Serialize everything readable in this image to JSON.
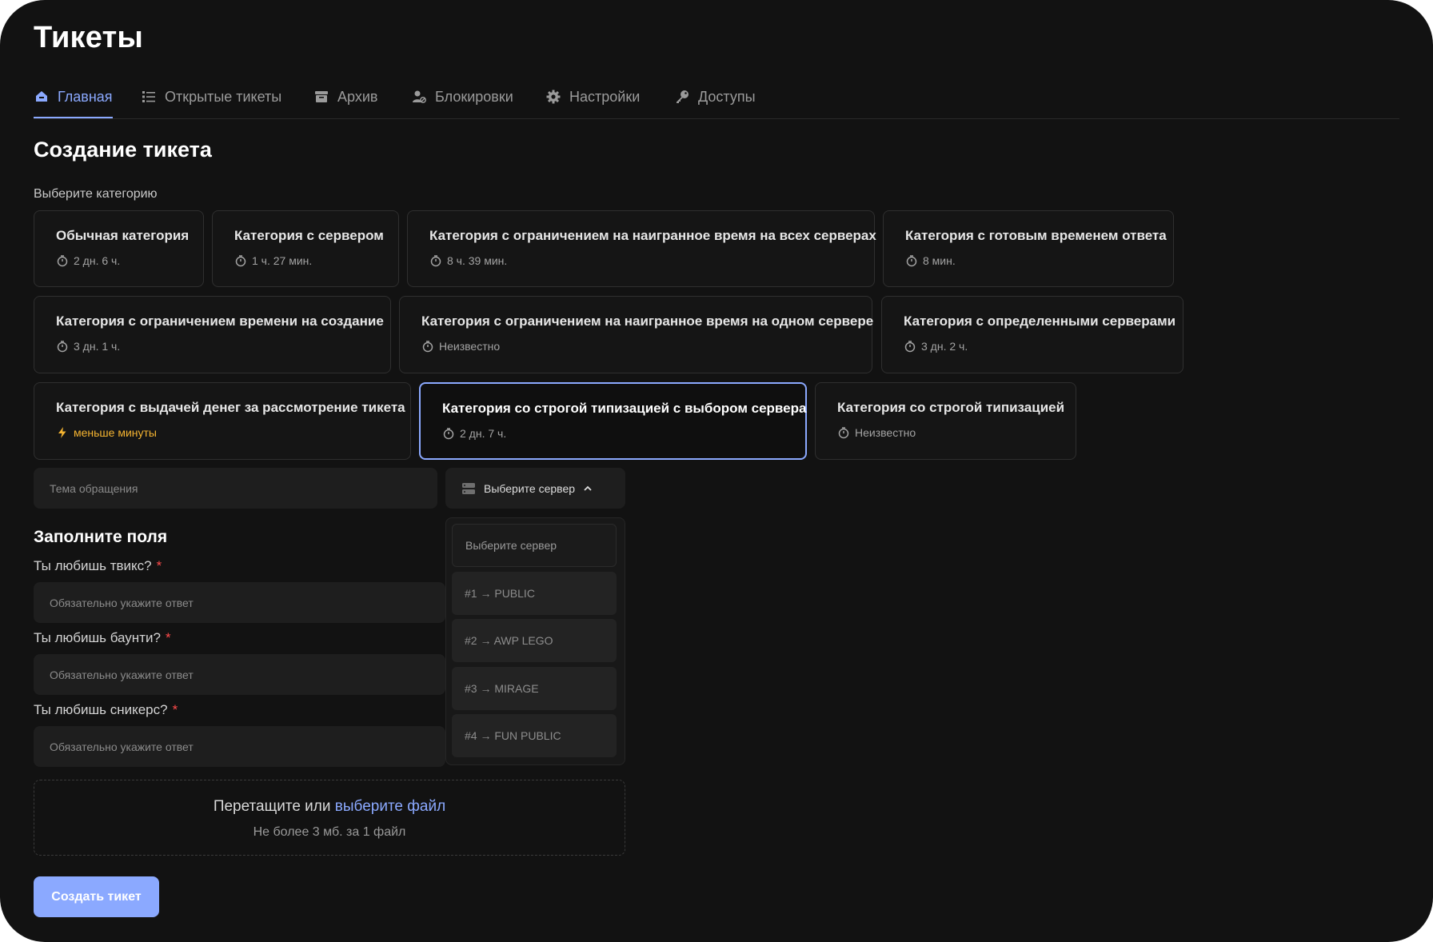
{
  "app": {
    "title": "Тикеты"
  },
  "tabs": [
    {
      "label": "Главная",
      "icon": "home-icon",
      "active": true
    },
    {
      "label": "Открытые тикеты",
      "icon": "list-icon"
    },
    {
      "label": "Архив",
      "icon": "archive-icon"
    },
    {
      "label": "Блокировки",
      "icon": "user-block-icon"
    },
    {
      "label": "Настройки",
      "icon": "gear-icon"
    },
    {
      "label": "Доступы",
      "icon": "key-icon"
    }
  ],
  "create": {
    "title": "Создание тикета",
    "choose_category_label": "Выберите категорию",
    "categories": [
      {
        "name": "Обычная категория",
        "time": "2 дн. 6 ч."
      },
      {
        "name": "Категория с сервером",
        "time": "1 ч. 27 мин."
      },
      {
        "name": "Категория с ограничением на наигранное время на всех серверах",
        "time": "8 ч. 39 мин."
      },
      {
        "name": "Категория с готовым временем ответа",
        "time": "8 мин."
      },
      {
        "name": "Категория с ограничением времени на создание",
        "time": "3 дн. 1 ч."
      },
      {
        "name": "Категория с ограничением на наигранное время на одном сервере",
        "time": "Неизвестно"
      },
      {
        "name": "Категория с определенными серверами",
        "time": "3 дн. 2 ч."
      },
      {
        "name": "Категория с выдачей денег за рассмотрение тикета",
        "time": "меньше минуты",
        "fast": true
      },
      {
        "name": "Категория со строгой типизацией с выбором сервера",
        "time": "2 дн. 7 ч.",
        "selected": true
      },
      {
        "name": "Категория со строгой типизацией",
        "time": "Неизвестно"
      }
    ],
    "subject": {
      "placeholder": "Тема обращения",
      "value": ""
    },
    "server_select": {
      "label": "Выберите сервер",
      "open": true,
      "options": [
        "Выберите сервер",
        "#1 → PUBLIC",
        "#2 → AWP LEGO",
        "#3 → MIRAGE",
        "#4 → FUN PUBLIC"
      ]
    },
    "fields_title": "Заполните поля",
    "questions": [
      {
        "label": "Ты любишь твикс?",
        "required_mark": "*",
        "placeholder": "Обязательно укажите ответ"
      },
      {
        "label": "Ты любишь баунти?",
        "required_mark": "*",
        "placeholder": "Обязательно укажите ответ"
      },
      {
        "label": "Ты любишь сникерс?",
        "required_mark": "*",
        "placeholder": "Обязательно укажите ответ"
      }
    ],
    "upload": {
      "text": "Перетащите или",
      "link": "выберите файл",
      "hint": "Не более 3 мб. за 1 файл"
    },
    "submit_label": "Создать тикет"
  },
  "colors": {
    "background": "#121212",
    "accent": "#8ba9ff",
    "required": "#ff4b4b",
    "fast_time": "#f5b431"
  }
}
